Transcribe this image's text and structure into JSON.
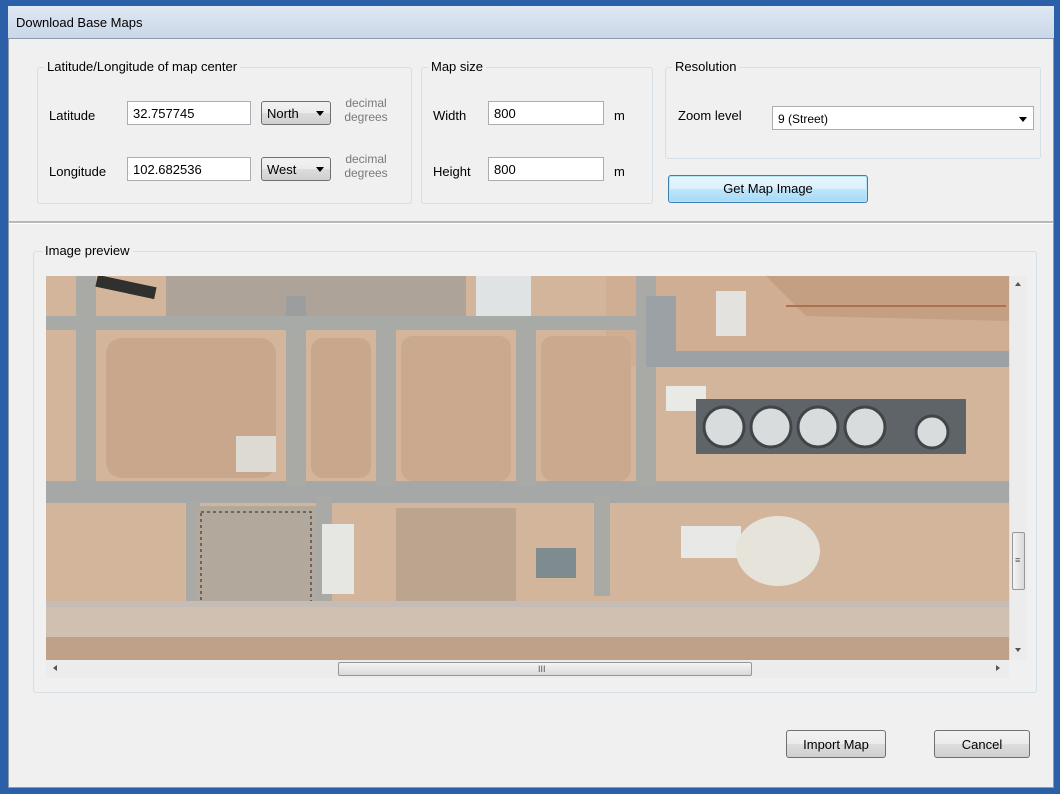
{
  "window": {
    "title": "Download Base Maps"
  },
  "center": {
    "legend": "Latitude/Longitude of map center",
    "latitude_label": "Latitude",
    "latitude_value": "32.757745",
    "latitude_dir": "North",
    "longitude_label": "Longitude",
    "longitude_value": "102.682536",
    "longitude_dir": "West",
    "unit_line1": "decimal",
    "unit_line2": "degrees"
  },
  "map_size": {
    "legend": "Map size",
    "width_label": "Width",
    "width_value": "800",
    "height_label": "Height",
    "height_value": "800",
    "unit": "m"
  },
  "resolution": {
    "legend": "Resolution",
    "zoom_label": "Zoom level",
    "zoom_value": "9 (Street)"
  },
  "actions": {
    "get_map": "Get Map Image",
    "import_map": "Import Map",
    "cancel": "Cancel"
  },
  "preview": {
    "legend": "Image preview",
    "scroll_grip": "III",
    "vscroll_grip": "≡"
  },
  "colors": {
    "title_bar": "#dfe8f3",
    "frame": "#2b5fa8",
    "face": "#f0f0f0",
    "ground": "#d3b79e",
    "road": "#a6a8a8"
  }
}
